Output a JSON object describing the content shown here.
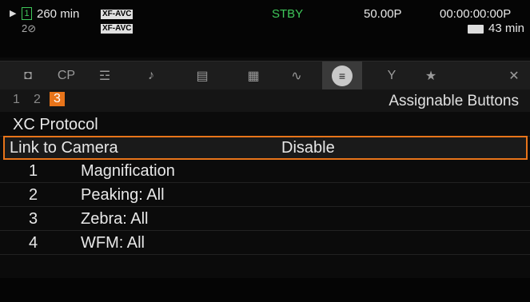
{
  "status": {
    "play_icon": "play-triangle",
    "media_slot": "1",
    "remaining": "260 min",
    "codec1": "XF-AVC",
    "codec2": "XF-AVC",
    "slot2_icon": "2⊘",
    "mode": "STBY",
    "frame_rate": "50.00P",
    "timecode": "00:00:00:00P",
    "battery": "43 min"
  },
  "tabs": [
    {
      "name": "camera-menu",
      "glyph": "◘"
    },
    {
      "name": "custom-picture",
      "glyph": "CP"
    },
    {
      "name": "camera-setup",
      "glyph": "☲"
    },
    {
      "name": "audio",
      "glyph": "♪"
    },
    {
      "name": "recording",
      "glyph": "▤"
    },
    {
      "name": "display",
      "glyph": "▦"
    },
    {
      "name": "waveform",
      "glyph": "∿"
    },
    {
      "name": "assignable",
      "glyph": "≡"
    },
    {
      "name": "system",
      "glyph": "Y"
    },
    {
      "name": "my-menu",
      "glyph": "★"
    },
    {
      "name": "close",
      "glyph": "✕"
    }
  ],
  "active_tab": 7,
  "pages": [
    "1",
    "2",
    "3"
  ],
  "current_page": "3",
  "screen_title": "Assignable Buttons",
  "section_title": "XC Protocol",
  "link": {
    "label": "Link to Camera",
    "value": "Disable"
  },
  "buttons": [
    {
      "num": "1",
      "value": "Magnification"
    },
    {
      "num": "2",
      "value": "Peaking: All"
    },
    {
      "num": "3",
      "value": "Zebra: All"
    },
    {
      "num": "4",
      "value": "WFM: All"
    }
  ],
  "colors": {
    "accent": "#e8741a",
    "standby": "#3fc85a"
  }
}
